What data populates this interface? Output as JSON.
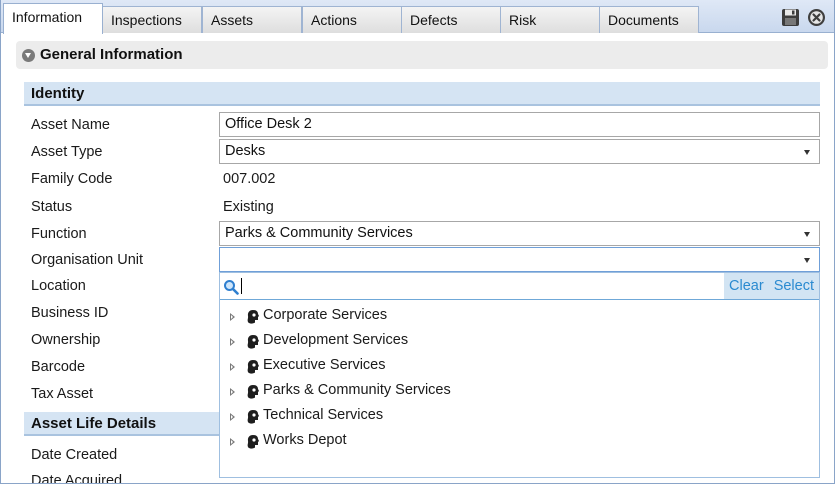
{
  "tabs": [
    {
      "label": "Information",
      "active": true
    },
    {
      "label": "Inspections",
      "active": false
    },
    {
      "label": "Assets",
      "active": false
    },
    {
      "label": "Actions",
      "active": false
    },
    {
      "label": "Defects",
      "active": false
    },
    {
      "label": "Risk",
      "active": false
    },
    {
      "label": "Documents",
      "active": false
    }
  ],
  "toolbar": {
    "save_icon": "save-icon",
    "close_icon": "close-circle-icon"
  },
  "section": {
    "title": "General Information"
  },
  "identity": {
    "title": "Identity",
    "fields": {
      "asset_name": {
        "label": "Asset Name",
        "value": "Office Desk 2"
      },
      "asset_type": {
        "label": "Asset Type",
        "value": "Desks"
      },
      "family_code": {
        "label": "Family Code",
        "value": "007.002"
      },
      "status": {
        "label": "Status",
        "value": "Existing"
      },
      "function": {
        "label": "Function",
        "value": "Parks & Community Services"
      },
      "org_unit": {
        "label": "Organisation Unit",
        "value": ""
      },
      "location": {
        "label": "Location"
      },
      "business_id": {
        "label": "Business ID"
      },
      "ownership": {
        "label": "Ownership"
      },
      "barcode": {
        "label": "Barcode"
      },
      "tax_asset": {
        "label": "Tax Asset"
      }
    }
  },
  "life": {
    "title": "Asset Life Details",
    "fields": {
      "date_created": {
        "label": "Date Created"
      },
      "date_acquired": {
        "label": "Date Acquired"
      }
    }
  },
  "dropdown": {
    "search_value": "",
    "clear_label": "Clear",
    "select_label": "Select",
    "items": [
      "Corporate Services",
      "Development Services",
      "Executive Services",
      "Parks & Community Services",
      "Technical Services",
      "Works Depot"
    ]
  },
  "colors": {
    "accent": "#2a8ad0",
    "group_bg": "#d5e4f3",
    "tab_bar": "#c9d8ee"
  }
}
